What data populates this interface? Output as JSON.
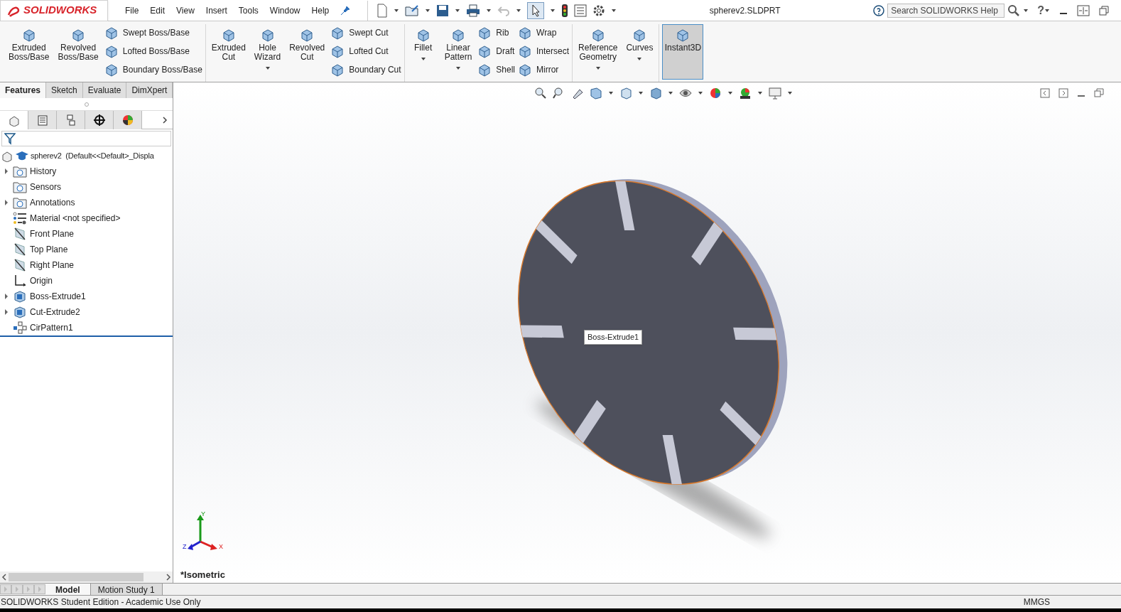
{
  "app": {
    "logo": "SOLIDWORKS",
    "menus": [
      "File",
      "Edit",
      "View",
      "Insert",
      "Tools",
      "Window",
      "Help"
    ],
    "title": "spherev2.SLDPRT",
    "help_search": {
      "placeholder": "Search SOLIDWORKS Help"
    },
    "help_button": "?"
  },
  "ribbon": {
    "groups": [
      {
        "columns": [
          {
            "kind": "large",
            "label": "Extruded Boss/Base",
            "dropdown": false,
            "on": false
          },
          {
            "kind": "large",
            "label": "Revolved Boss/Base",
            "dropdown": false,
            "on": false
          },
          {
            "kind": "stack",
            "items": [
              "Swept Boss/Base",
              "Lofted Boss/Base",
              "Boundary Boss/Base"
            ]
          }
        ]
      },
      {
        "columns": [
          {
            "kind": "large",
            "label": "Extruded Cut",
            "dropdown": false,
            "on": false
          },
          {
            "kind": "large",
            "label": "Hole Wizard",
            "dropdown": true,
            "on": false
          },
          {
            "kind": "large",
            "label": "Revolved Cut",
            "dropdown": false,
            "on": false
          },
          {
            "kind": "stack",
            "items": [
              "Swept Cut",
              "Lofted Cut",
              "Boundary Cut"
            ]
          }
        ]
      },
      {
        "columns": [
          {
            "kind": "large",
            "label": "Fillet",
            "dropdown": true,
            "on": false
          },
          {
            "kind": "large",
            "label": "Linear Pattern",
            "dropdown": true,
            "on": false
          },
          {
            "kind": "stack",
            "items": [
              "Rib",
              "Draft",
              "Shell"
            ]
          },
          {
            "kind": "stack",
            "items": [
              "Wrap",
              "Intersect",
              "Mirror"
            ]
          }
        ]
      },
      {
        "columns": [
          {
            "kind": "large",
            "label": "Reference Geometry",
            "dropdown": true,
            "on": false
          },
          {
            "kind": "large",
            "label": "Curves",
            "dropdown": true,
            "on": false
          }
        ]
      },
      {
        "columns": [
          {
            "kind": "large",
            "label": "Instant3D",
            "dropdown": false,
            "on": true
          }
        ]
      }
    ]
  },
  "command_tabs": [
    {
      "label": "Features",
      "selected": true
    },
    {
      "label": "Sketch",
      "selected": false
    },
    {
      "label": "Evaluate",
      "selected": false
    },
    {
      "label": "DimXpert",
      "selected": false
    }
  ],
  "tree": {
    "root": "spherev2  (Default<<Default>_Displa",
    "children": [
      {
        "label": "History",
        "kind": "folder",
        "expandable": true
      },
      {
        "label": "Sensors",
        "kind": "folder",
        "expandable": false
      },
      {
        "label": "Annotations",
        "kind": "folder",
        "expandable": true
      },
      {
        "label": "Material <not specified>",
        "kind": "material",
        "expandable": false
      },
      {
        "label": "Front Plane",
        "kind": "plane",
        "expandable": false
      },
      {
        "label": "Top Plane",
        "kind": "plane",
        "expandable": false
      },
      {
        "label": "Right Plane",
        "kind": "plane",
        "expandable": false
      },
      {
        "label": "Origin",
        "kind": "origin",
        "expandable": false
      },
      {
        "label": "Boss-Extrude1",
        "kind": "feature",
        "expandable": true
      },
      {
        "label": "Cut-Extrude2",
        "kind": "feature",
        "expandable": true
      },
      {
        "label": "CirPattern1",
        "kind": "pattern",
        "expandable": false
      }
    ]
  },
  "panel_tabs": [
    {
      "selected": true
    },
    {
      "selected": false
    },
    {
      "selected": false
    },
    {
      "selected": false
    },
    {
      "selected": false
    }
  ],
  "viewport": {
    "tooltip": "Boss-Extrude1",
    "view_name": "*Isometric",
    "axes": [
      "Y",
      "Z",
      "X"
    ]
  },
  "bottom_tabs": [
    {
      "label": "Model",
      "selected": true
    },
    {
      "label": "Motion Study 1",
      "selected": false
    }
  ],
  "status_bar": {
    "text": "SOLIDWORKS Student Edition - Academic Use Only",
    "units": "MMGS"
  }
}
